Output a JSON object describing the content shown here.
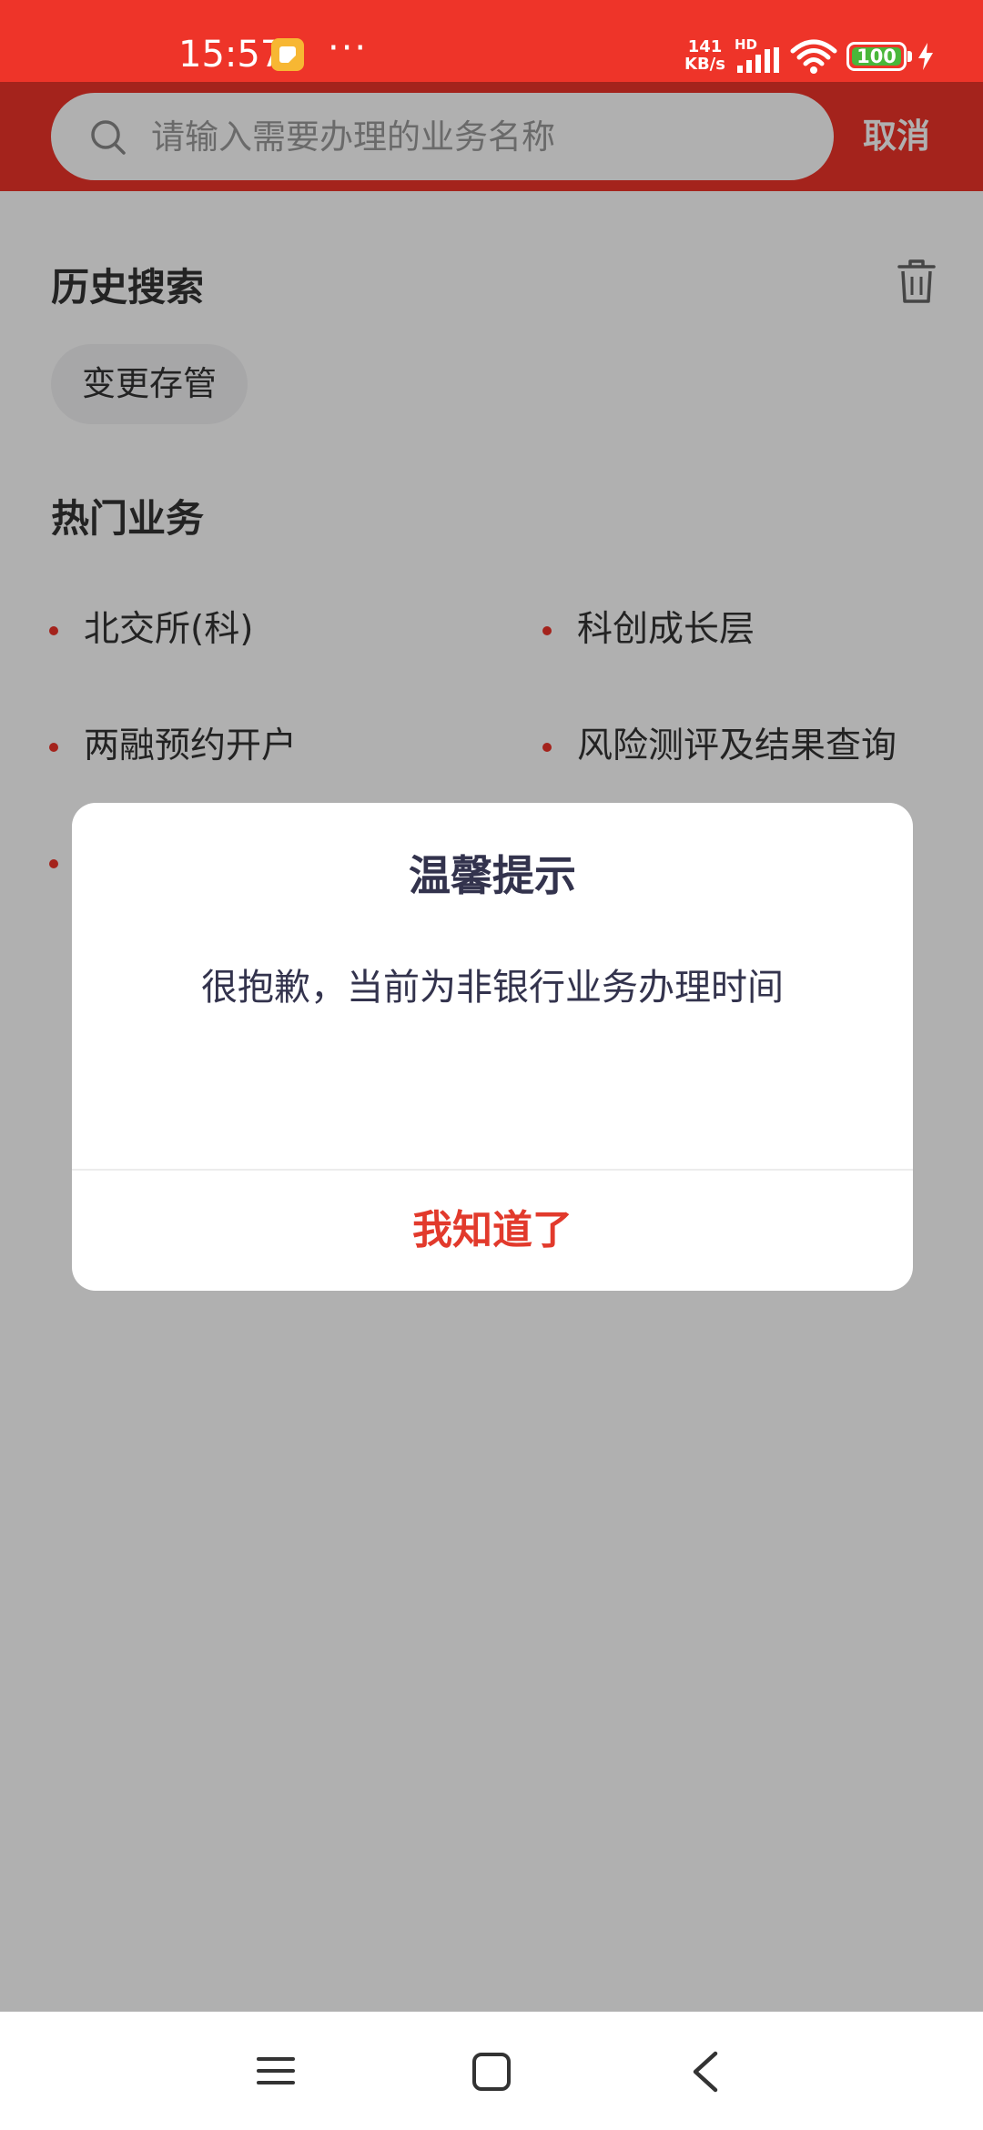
{
  "status_bar": {
    "time": "15:57",
    "more": "···",
    "net_speed_value": "141",
    "net_speed_unit": "KB/s",
    "network_tag": "HD",
    "battery": "100"
  },
  "search": {
    "placeholder": "请输入需要办理的业务名称",
    "cancel_label": "取消"
  },
  "history": {
    "title": "历史搜索",
    "items": [
      "变更存管"
    ]
  },
  "hot": {
    "title": "热门业务",
    "items": [
      "北交所(科)",
      "科创成长层",
      "两融预约开户",
      "风险测评及结果查询"
    ]
  },
  "dialog": {
    "title": "温馨提示",
    "message": "很抱歉，当前为非银行业务办理时间",
    "confirm_label": "我知道了"
  },
  "colors": {
    "brand_red": "#ee3429",
    "dialog_button": "#e23a2c",
    "battery_green": "#49b73a"
  },
  "icons": [
    "search-icon",
    "trash-icon",
    "signal-icon",
    "wifi-icon",
    "battery-icon",
    "charging-icon",
    "menu-icon",
    "home-icon",
    "back-icon"
  ]
}
